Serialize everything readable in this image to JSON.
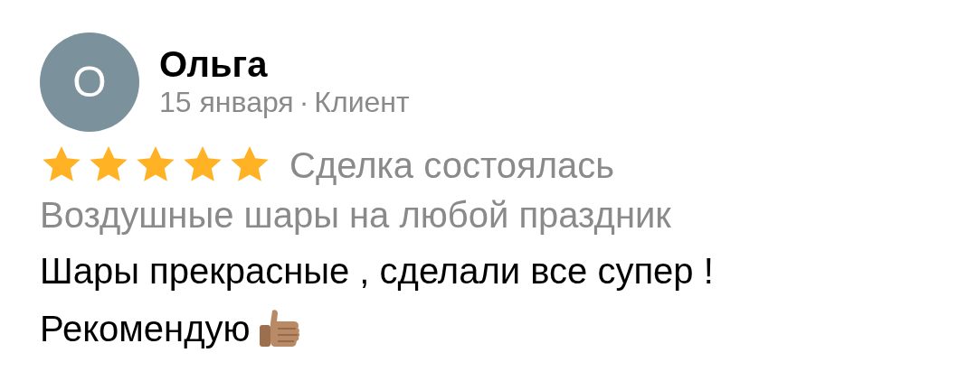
{
  "review": {
    "avatar_letter": "О",
    "author": "Ольга",
    "date": "15 января",
    "separator": "·",
    "role": "Клиент",
    "stars": 5,
    "deal_status": "Сделка состоялась",
    "service": "Воздушные шары на любой праздник",
    "text_lines": [
      "Шары прекрасные , сделали все супер !",
      "Рекомендую"
    ]
  }
}
